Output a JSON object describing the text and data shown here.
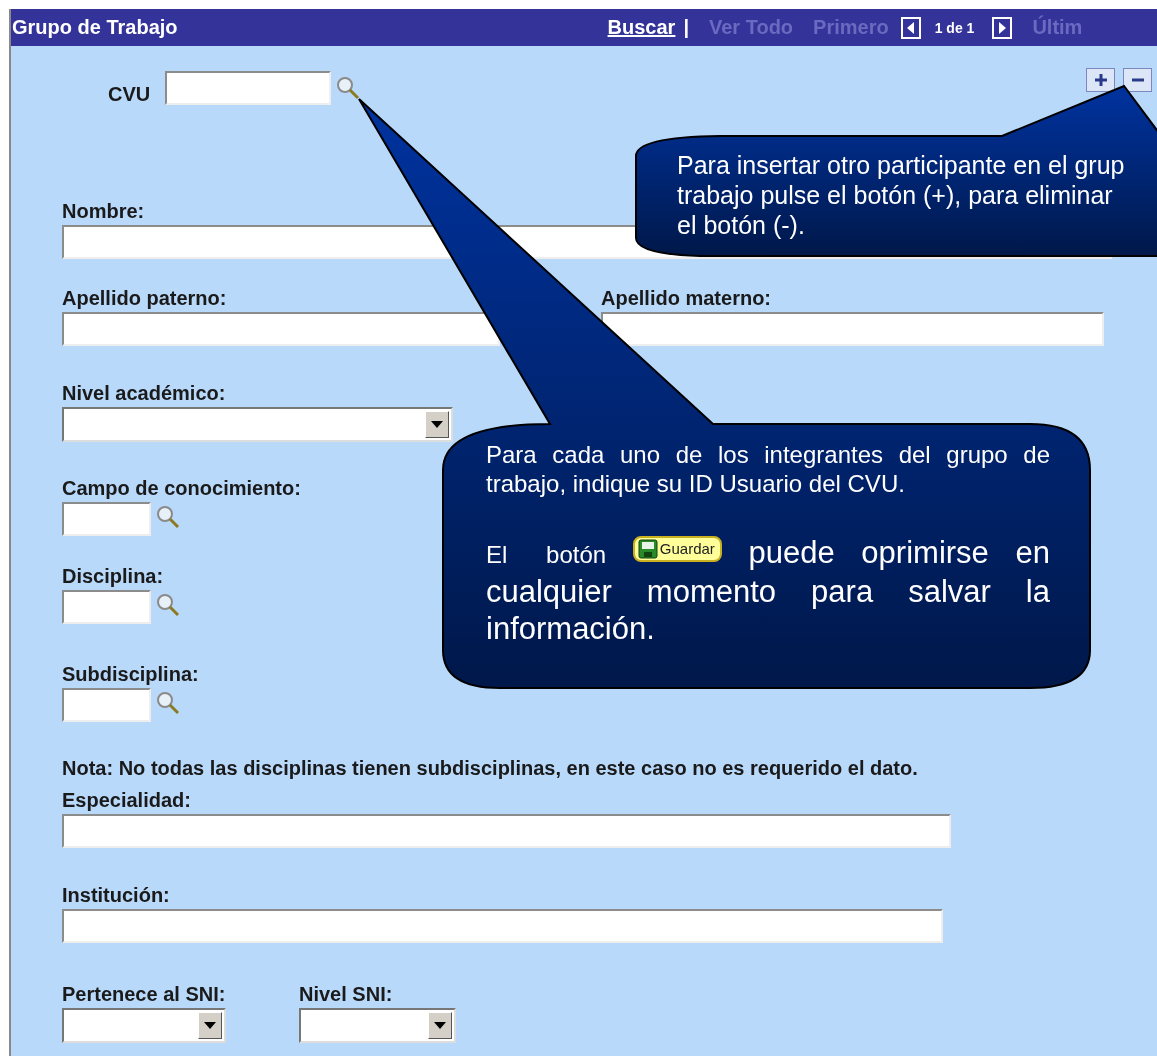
{
  "header": {
    "title": "Grupo de Trabajo",
    "nav": [
      {
        "kind": "link",
        "label": "Buscar",
        "disabled": false
      },
      {
        "kind": "separator",
        "label": "|"
      },
      {
        "kind": "link",
        "label": "Ver Todo",
        "disabled": true
      },
      {
        "kind": "link",
        "label": "Primero",
        "disabled": true
      },
      {
        "kind": "prev"
      },
      {
        "kind": "count",
        "label": "1 de 1"
      },
      {
        "kind": "next"
      },
      {
        "kind": "link",
        "label": "Últim",
        "disabled": true
      }
    ]
  },
  "cvu": {
    "label": "CVU"
  },
  "rows": [
    {
      "fields": [
        {
          "kind": "text",
          "label": "Nombre:"
        }
      ]
    },
    {
      "fields": [
        {
          "kind": "text",
          "label": "Apellido paterno:"
        },
        {
          "kind": "text",
          "label": "Apellido materno:"
        }
      ]
    },
    {
      "fields": [
        {
          "kind": "select",
          "label": "Nivel académico:"
        }
      ]
    },
    {
      "fields": [
        {
          "kind": "lookup",
          "label": "Campo de conocimiento:"
        }
      ]
    },
    {
      "fields": [
        {
          "kind": "lookup",
          "label": "Disciplina:"
        }
      ]
    },
    {
      "fields": [
        {
          "kind": "lookup",
          "label": "Subdisciplina:"
        }
      ]
    },
    {
      "fields": [
        {
          "kind": "note",
          "label": "Nota: No todas las disciplinas tienen subdisciplinas, en este caso no es requerido el dato."
        }
      ]
    },
    {
      "fields": [
        {
          "kind": "text",
          "label": "Especialidad:"
        }
      ]
    },
    {
      "fields": [
        {
          "kind": "text",
          "label": "Institución:"
        }
      ]
    },
    {
      "fields": [
        {
          "kind": "select",
          "label": "Pertenece al SNI:"
        },
        {
          "kind": "select",
          "label": "Nivel SNI:"
        }
      ]
    }
  ],
  "row_help": {
    "lines": [
      "Para insertar otro participante en el grup",
      "trabajo pulse el botón (+), para eliminar",
      "el botón (-)."
    ]
  },
  "cvu_help": {
    "intro": "Para cada uno de los integrantes del grupo de trabajo, indique su ID Usuario del CVU.",
    "lead": "El botón",
    "button": "Guardar",
    "rest": "puede oprimirse en cualquier momento para salvar la información."
  }
}
